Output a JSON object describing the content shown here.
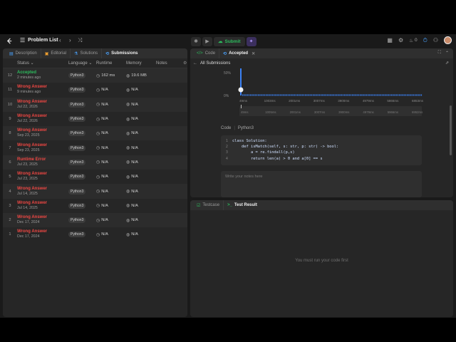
{
  "topbar": {
    "title": "Problem List",
    "submit_label": "Submit",
    "streak": "0"
  },
  "left_tabs": [
    {
      "label": "Description",
      "icon": "description-icon"
    },
    {
      "label": "Editorial",
      "icon": "editorial-icon"
    },
    {
      "label": "Solutions",
      "icon": "solutions-icon"
    },
    {
      "label": "Submissions",
      "icon": "submissions-icon"
    }
  ],
  "table": {
    "headers": {
      "status": "Status",
      "language": "Language",
      "runtime": "Runtime",
      "memory": "Memory",
      "notes": "Notes"
    },
    "rows": [
      {
        "num": "12",
        "status": "Accepted",
        "date": "2 minutes ago",
        "lang": "Python3",
        "runtime": "162 ms",
        "memory": "19.6 MB",
        "kind": "acc"
      },
      {
        "num": "11",
        "status": "Wrong Answer",
        "date": "9 minutes ago",
        "lang": "Python3",
        "runtime": "N/A",
        "memory": "N/A",
        "kind": "wrong"
      },
      {
        "num": "10",
        "status": "Wrong Answer",
        "date": "Jul 22, 2026",
        "lang": "Python3",
        "runtime": "N/A",
        "memory": "N/A",
        "kind": "wrong"
      },
      {
        "num": "9",
        "status": "Wrong Answer",
        "date": "Jul 22, 2026",
        "lang": "Python3",
        "runtime": "N/A",
        "memory": "N/A",
        "kind": "wrong"
      },
      {
        "num": "8",
        "status": "Wrong Answer",
        "date": "Sep 23, 2025",
        "lang": "Python3",
        "runtime": "N/A",
        "memory": "N/A",
        "kind": "wrong"
      },
      {
        "num": "7",
        "status": "Wrong Answer",
        "date": "Sep 23, 2025",
        "lang": "Python3",
        "runtime": "N/A",
        "memory": "N/A",
        "kind": "wrong"
      },
      {
        "num": "6",
        "status": "Runtime Error",
        "date": "Jul 23, 2025",
        "lang": "Python3",
        "runtime": "N/A",
        "memory": "N/A",
        "kind": "wrong"
      },
      {
        "num": "5",
        "status": "Wrong Answer",
        "date": "Jul 23, 2025",
        "lang": "Python3",
        "runtime": "N/A",
        "memory": "N/A",
        "kind": "wrong"
      },
      {
        "num": "4",
        "status": "Wrong Answer",
        "date": "Jul 14, 2025",
        "lang": "Python3",
        "runtime": "N/A",
        "memory": "N/A",
        "kind": "wrong"
      },
      {
        "num": "3",
        "status": "Wrong Answer",
        "date": "Jul 14, 2025",
        "lang": "Python3",
        "runtime": "N/A",
        "memory": "N/A",
        "kind": "wrong"
      },
      {
        "num": "2",
        "status": "Wrong Answer",
        "date": "Dec 17, 2024",
        "lang": "Python3",
        "runtime": "N/A",
        "memory": "N/A",
        "kind": "wrong"
      },
      {
        "num": "1",
        "status": "Wrong Answer",
        "date": "Dec 17, 2024",
        "lang": "Python3",
        "runtime": "N/A",
        "memory": "N/A",
        "kind": "wrong"
      }
    ]
  },
  "right_top": {
    "code_tab": "Code",
    "accepted_tab": "Accepted",
    "back_label": "All Submissions",
    "code_label": "Code",
    "lang_label": "Python3",
    "notes_placeholder": "Write your notes here"
  },
  "chart_data": {
    "type": "bar",
    "ylabels": [
      "50%",
      "0%"
    ],
    "ylim": [
      0,
      60
    ],
    "categories": [
      "49ms",
      "1003ms",
      "2001ms",
      "3007ms",
      "3900ms",
      "4979ms",
      "5866ms",
      "6853ms"
    ],
    "overview_labels": [
      "49ms",
      "1005ms",
      "2001ms",
      "3007ms",
      "3900ms",
      "4979ms",
      "5966ms",
      "6952ms"
    ],
    "spike_value": 58,
    "baseline_value": 1
  },
  "code": [
    {
      "n": "1",
      "text": "class Solution:"
    },
    {
      "n": "2",
      "text": "    def isMatch(self, s: str, p: str) -> bool:"
    },
    {
      "n": "3",
      "text": "        a = re.findall(p,s)"
    },
    {
      "n": "4",
      "text": "        return len(a) > 0 and a[0] == s"
    }
  ],
  "bottom": {
    "tab_testcase": "Testcase",
    "tab_result": "Test Result",
    "empty_message": "You must run your code first"
  },
  "colors": {
    "accent_green": "#2cbb5d",
    "error_red": "#ef4743",
    "chart_blue": "#3b82f6"
  }
}
